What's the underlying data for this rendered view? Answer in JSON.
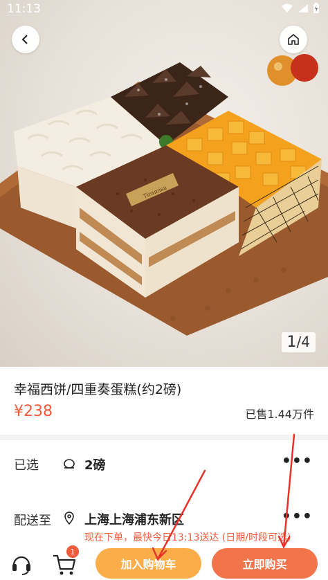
{
  "status_bar": {
    "time": "11:13"
  },
  "hero": {
    "page_current": "1",
    "page_sep": "/",
    "page_total": "4",
    "brand_plaque": "Tiramisu"
  },
  "product": {
    "title": "幸福西饼/四重奏蛋糕(约2磅)",
    "price": "¥238",
    "sold": "已售1.44万件"
  },
  "options": {
    "selected_label": "已选",
    "selected_value": "2磅",
    "delivery_label": "配送至",
    "delivery_value": "上海上海浦东新区",
    "delivery_notice": "现在下单，最快今日13:13送达 (日期/时段可选)",
    "more": "•••"
  },
  "bottom_bar": {
    "cart_count": "1",
    "add_to_cart": "加入购物车",
    "buy_now": "立即购买"
  },
  "colors": {
    "accent": "#f25a3a",
    "cart_button": "#fbad4a",
    "buy_button": "#f2744a",
    "annotation": "#e8322a"
  }
}
